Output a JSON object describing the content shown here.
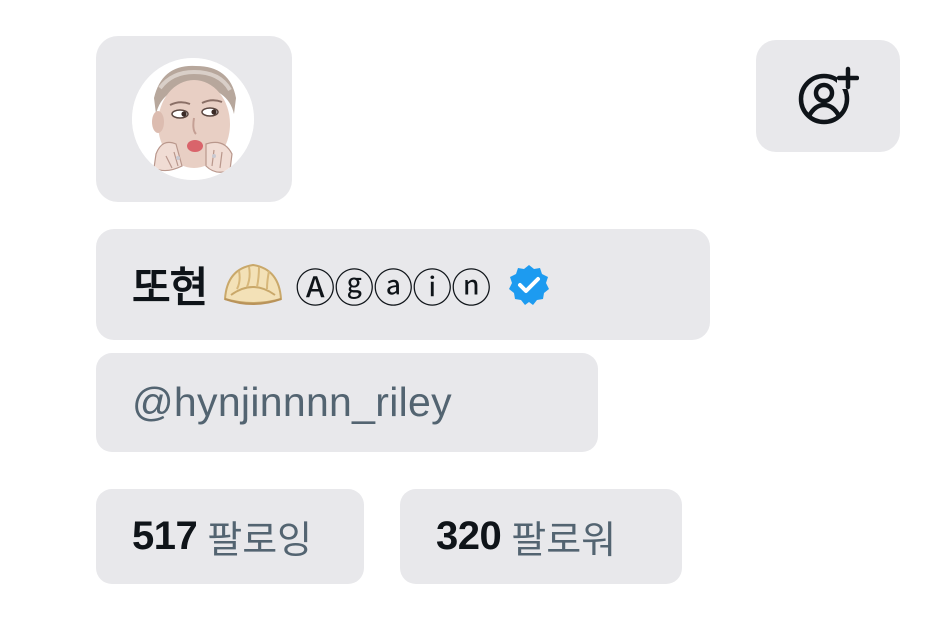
{
  "profile": {
    "display_name": "또현",
    "display_name_emoji": "dumpling-emoji",
    "display_name_suffix": "Ⓐⓖⓐⓘⓝ",
    "verified": true,
    "handle": "@hynjinnnn_riley"
  },
  "stats": {
    "following": {
      "count": "517",
      "label": "팔로잉"
    },
    "followers": {
      "count": "320",
      "label": "팔로워"
    }
  },
  "actions": {
    "follow_icon": "add-user-icon"
  },
  "colors": {
    "card_bg": "#e8e8eb",
    "text_primary": "#0f1419",
    "text_secondary": "#536471",
    "verified_blue": "#1d9bf0"
  }
}
